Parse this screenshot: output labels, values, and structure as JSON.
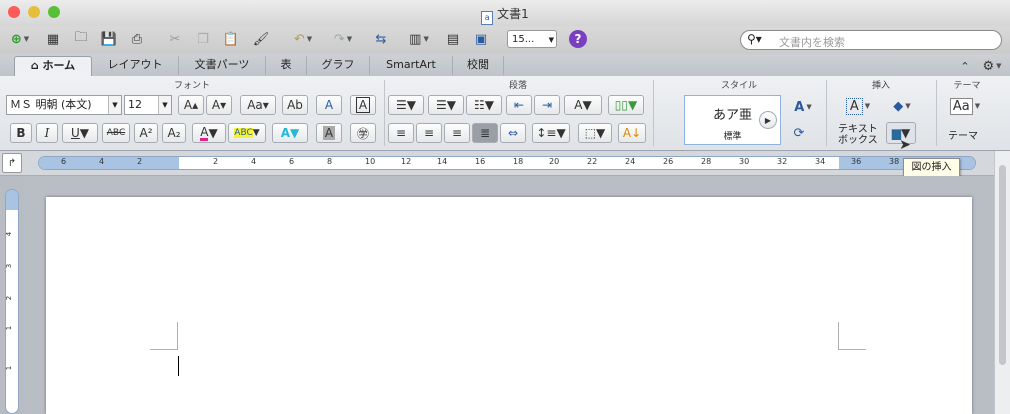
{
  "window": {
    "title": "文書1",
    "doc_icon_glyph": "a",
    "lights": [
      "#fc5b57",
      "#e5bf3c",
      "#57c038"
    ]
  },
  "toolbar": {
    "zoom": "15...",
    "help": "?",
    "search_placeholder": "文書内を検索"
  },
  "tabs": [
    {
      "label": "ホーム",
      "active": true
    },
    {
      "label": "レイアウト"
    },
    {
      "label": "文書パーツ"
    },
    {
      "label": "表"
    },
    {
      "label": "グラフ"
    },
    {
      "label": "SmartArt"
    },
    {
      "label": "校閲"
    }
  ],
  "ribbon": {
    "groups": {
      "font": "フォント",
      "paragraph": "段落",
      "style": "スタイル",
      "insert": "挿入",
      "theme": "テーマ"
    },
    "font_name": "ＭＳ 明朝 (本文)",
    "font_size": "12",
    "style_sample": "あア亜",
    "style_name": "標準",
    "textbox_label_1": "テキスト",
    "textbox_label_2": "ボックス",
    "theme_label": "テーマ",
    "theme_sample": "Aa"
  },
  "tooltip": "図の挿入",
  "ruler": {
    "h_ticks": [
      "6",
      "4",
      "2",
      "2",
      "4",
      "6",
      "8",
      "10",
      "12",
      "14",
      "16",
      "18",
      "20",
      "22",
      "24",
      "26",
      "28",
      "30",
      "32",
      "34",
      "36",
      "38"
    ],
    "v_ticks": [
      "4",
      "3",
      "2",
      "1",
      "1"
    ]
  }
}
